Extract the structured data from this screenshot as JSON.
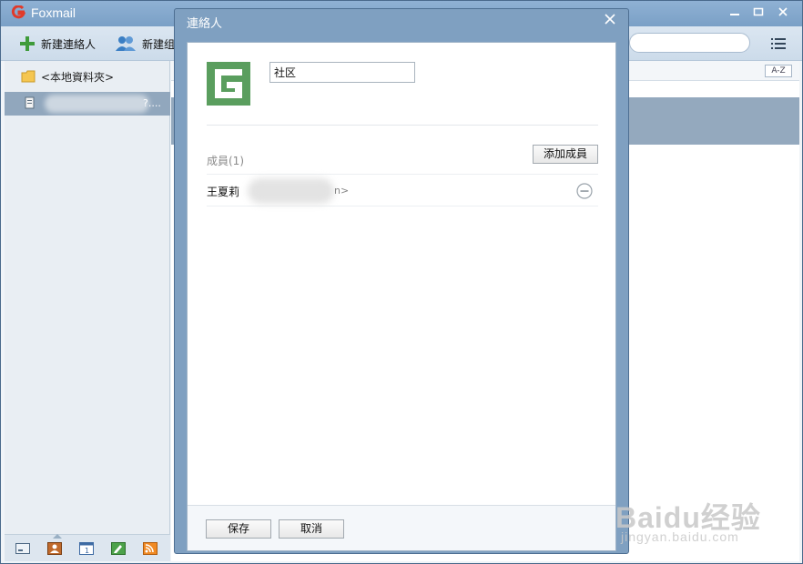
{
  "app": {
    "title": "Foxmail"
  },
  "toolbar": {
    "new_contact_label": "新建連絡人",
    "new_group_label": "新建组"
  },
  "sidebar": {
    "folder_label": "<本地資料夾>",
    "account_label": "?...."
  },
  "list": {
    "sort_label": "A-Z"
  },
  "dialog": {
    "title": "連絡人",
    "group_name_value": "社区",
    "members_label": "成員(1)",
    "add_member_label": "添加成員",
    "members": [
      {
        "name": "王夏莉",
        "email_tail": "n>"
      }
    ],
    "save_label": "保存",
    "cancel_label": "取消"
  },
  "watermark": {
    "main": "Baidu经验",
    "sub": "jingyan.baidu.com"
  },
  "colors": {
    "titlebar": "#7aa0c6",
    "group_logo": "#5a9e5e",
    "selection": "#94a9be"
  }
}
